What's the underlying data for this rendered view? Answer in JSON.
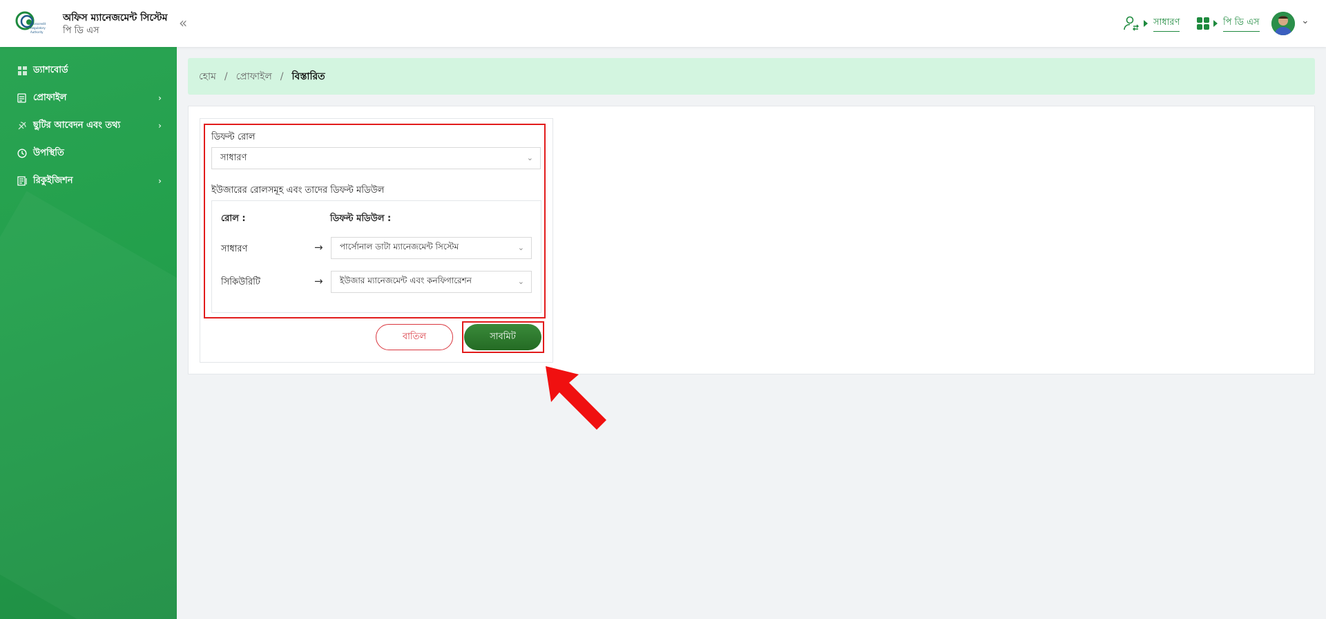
{
  "header": {
    "app_title": "অফিস ম্যানেজমেন্ট সিস্টেম",
    "app_subtitle": "পি ডি এস",
    "collapse_icon": "double-chevron-left",
    "role_label": "সাধারণ",
    "module_label": "পি ডি এস"
  },
  "sidebar": {
    "items": [
      {
        "label": "ড্যাশবোর্ড",
        "icon": "dashboard-icon",
        "has_children": false
      },
      {
        "label": "প্রোফাইল",
        "icon": "profile-icon",
        "has_children": true
      },
      {
        "label": "ছুটির আবেদন এবং তথ্য",
        "icon": "leave-icon",
        "has_children": true
      },
      {
        "label": "উপস্থিতি",
        "icon": "clock-icon",
        "has_children": false
      },
      {
        "label": "রিকুইজিশন",
        "icon": "requisition-icon",
        "has_children": true
      }
    ]
  },
  "breadcrumb": {
    "home": "হোম",
    "profile": "প্রোফাইল",
    "current": "বিস্তারিত",
    "separator": "/"
  },
  "form": {
    "default_role_label": "ডিফল্ট রোল",
    "default_role_value": "সাধারণ",
    "roles_section_label": "ইউজারের রোলসমূহ এবং তাদের ডিফল্ট মডিউল",
    "col_role": "রোল :",
    "col_module": "ডিফল্ট মডিউল :",
    "rows": [
      {
        "role": "সাধারণ",
        "module": "পার্সোনাল ডাটা ম্যানেজমেন্ট সিস্টেম"
      },
      {
        "role": "সিকিউরিটি",
        "module": "ইউজার ম্যানেজমেন্ট এবং কনফিগারেশন"
      }
    ],
    "cancel_label": "বাতিল",
    "submit_label": "সাবমিট"
  },
  "colors": {
    "brand_green": "#1e8a3e",
    "highlight_red": "#e21b1b",
    "breadcrumb_bg": "#d3f5e0"
  }
}
